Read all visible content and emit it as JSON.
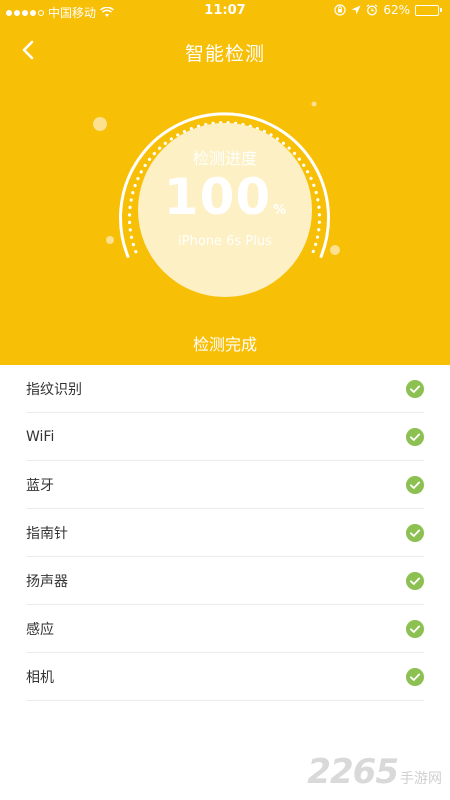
{
  "status_bar": {
    "carrier": "中国移动",
    "time": "11:07",
    "battery": "62%",
    "battery_level": 0.62
  },
  "nav": {
    "title": "智能检测",
    "back_icon": "chevron-left-icon"
  },
  "progress": {
    "label": "检测进度",
    "value": "100",
    "unit": "%",
    "device": "iPhone 6s Plus",
    "status": "检测完成"
  },
  "checks": [
    {
      "label": "指纹识别",
      "status": "passed"
    },
    {
      "label": "WiFi",
      "status": "passed"
    },
    {
      "label": "蓝牙",
      "status": "passed"
    },
    {
      "label": "指南针",
      "status": "passed"
    },
    {
      "label": "扬声器",
      "status": "passed"
    },
    {
      "label": "感应",
      "status": "passed"
    },
    {
      "label": "相机",
      "status": "passed"
    }
  ],
  "colors": {
    "brand": "#f8bf07",
    "check": "#8cc152"
  },
  "watermark": {
    "number": "2265",
    "text": "手游网"
  }
}
